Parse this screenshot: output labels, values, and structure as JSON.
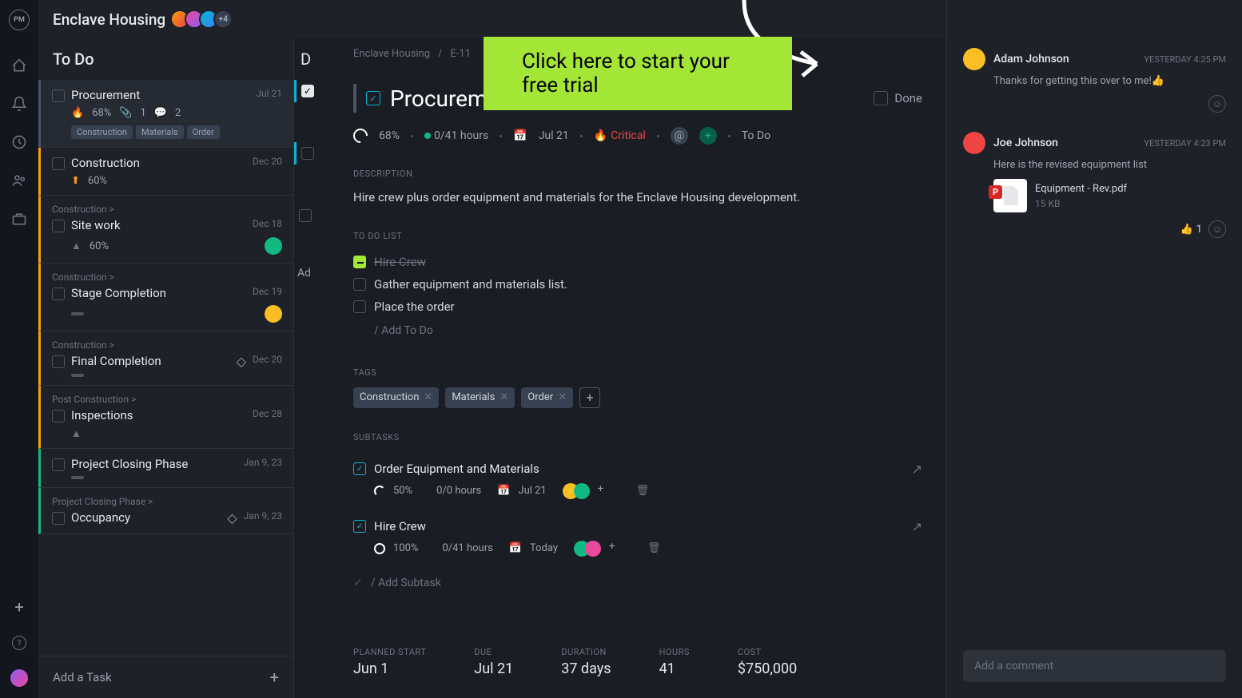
{
  "header": {
    "project": "Enclave Housing",
    "avatar_overflow": "+4"
  },
  "banner": {
    "cta": "Click here to start your free trial"
  },
  "sidebar": {
    "section_title": "To Do",
    "add_task": "Add a Task",
    "tasks": [
      {
        "name": "Procurement",
        "date": "Jul 21",
        "progress": "68%",
        "attachments": "1",
        "comments": "2",
        "tags": [
          "Construction",
          "Materials",
          "Order"
        ],
        "prio": "fire"
      },
      {
        "name": "Construction",
        "date": "Dec 20",
        "progress": "60%",
        "prio": "up"
      },
      {
        "breadcrumb": "Construction >",
        "name": "Site work",
        "date": "Dec 18",
        "progress": "60%",
        "prio": "arrow",
        "avatar": "#10b981"
      },
      {
        "breadcrumb": "Construction >",
        "name": "Stage Completion",
        "date": "Dec 19",
        "bar": true,
        "avatar": "#fbbf24"
      },
      {
        "breadcrumb": "Construction >",
        "name": "Final Completion",
        "date": "Dec 20",
        "diamond": true,
        "bar": true
      },
      {
        "breadcrumb": "Post Construction >",
        "name": "Inspections",
        "date": "Dec 28",
        "prio": "arrow"
      },
      {
        "name": "Project Closing Phase",
        "date": "Jan 9, 23",
        "bar": true,
        "green": true
      },
      {
        "breadcrumb": "Project Closing Phase >",
        "name": "Occupancy",
        "date": "Jan 9, 23",
        "diamond": true,
        "green": true
      }
    ]
  },
  "middle": {
    "title": "D",
    "add": "Ad"
  },
  "detail": {
    "breadcrumb": {
      "project": "Enclave Housing",
      "id": "E-11"
    },
    "title": "Procurement",
    "done_label": "Done",
    "meta": {
      "progress": "68%",
      "hours": "0/41 hours",
      "due": "Jul 21",
      "priority": "Critical",
      "status": "To Do"
    },
    "description_label": "Description",
    "description": "Hire crew plus order equipment and materials for the Enclave Housing development.",
    "todo_label": "To Do List",
    "todos": [
      {
        "text": "Hire Crew",
        "done": true
      },
      {
        "text": "Gather equipment and materials list.",
        "done": false
      },
      {
        "text": "Place the order",
        "done": false
      }
    ],
    "add_todo": "/ Add To Do",
    "tags_label": "Tags",
    "tags": [
      "Construction",
      "Materials",
      "Order"
    ],
    "subtasks_label": "Subtasks",
    "subtasks": [
      {
        "name": "Order Equipment and Materials",
        "progress": "50%",
        "hours": "0/0 hours",
        "due": "Jul 21"
      },
      {
        "name": "Hire Crew",
        "progress": "100%",
        "hours": "0/41 hours",
        "due": "Today"
      }
    ],
    "add_subtask": "/ Add Subtask",
    "stats": {
      "planned_start": {
        "label": "Planned Start",
        "value": "Jun 1"
      },
      "due": {
        "label": "Due",
        "value": "Jul 21"
      },
      "duration": {
        "label": "Duration",
        "value": "37 days"
      },
      "hours": {
        "label": "Hours",
        "value": "41"
      },
      "cost": {
        "label": "Cost",
        "value": "$750,000"
      }
    }
  },
  "comments": {
    "items": [
      {
        "name": "Adam Johnson",
        "time": "YESTERDAY 4:25 PM",
        "body": "Thanks for getting this over to me!👍"
      },
      {
        "name": "Joe Johnson",
        "time": "YESTERDAY 4:23 PM",
        "body": "Here is the revised equipment list",
        "file": {
          "name": "Equipment - Rev.pdf",
          "size": "15 KB"
        }
      }
    ],
    "reaction": {
      "emoji": "👍",
      "count": "1"
    },
    "placeholder": "Add a comment"
  }
}
